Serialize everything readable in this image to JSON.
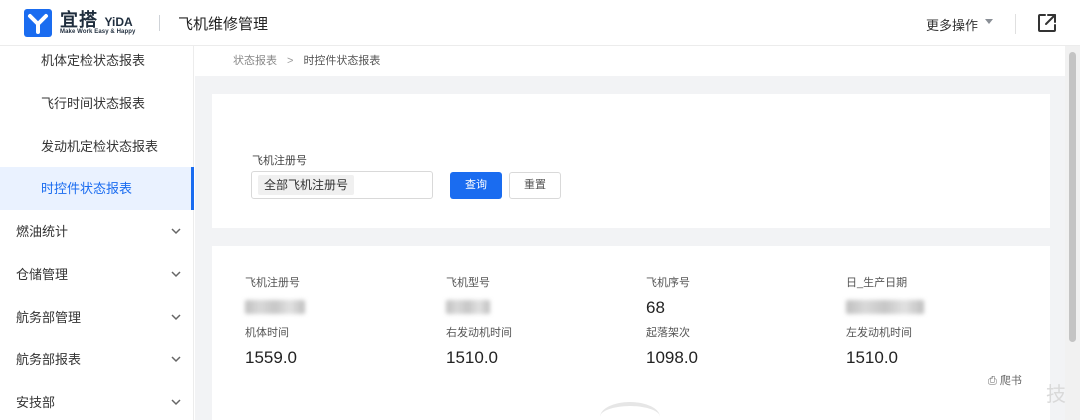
{
  "header": {
    "brand_cn": "宜搭",
    "brand_en": "YiDA",
    "brand_slogan": "Make Work Easy & Happy",
    "app_title": "飞机维修管理",
    "more_ops": "更多操作"
  },
  "sidebar": {
    "sub_items": [
      {
        "label": "机体定检状态报表",
        "active": false
      },
      {
        "label": "飞行时间状态报表",
        "active": false
      },
      {
        "label": "发动机定检状态报表",
        "active": false
      },
      {
        "label": "时控件状态报表",
        "active": true
      }
    ],
    "groups": [
      {
        "label": "燃油统计"
      },
      {
        "label": "仓储管理"
      },
      {
        "label": "航务部管理"
      },
      {
        "label": "航务部报表"
      },
      {
        "label": "安技部"
      }
    ]
  },
  "breadcrumb": {
    "parent": "状态报表",
    "separator": ">",
    "current": "时控件状态报表"
  },
  "query": {
    "field_label": "飞机注册号",
    "tag_value": "全部飞机注册号",
    "query_button": "查询",
    "reset_button": "重置"
  },
  "info": {
    "row1": [
      {
        "label": "飞机注册号",
        "value": ""
      },
      {
        "label": "飞机型号",
        "value": ""
      },
      {
        "label": "飞机序号",
        "value": "68"
      },
      {
        "label": "日_生产日期",
        "value": ""
      }
    ],
    "row2": [
      {
        "label": "机体时间",
        "value": "1559.0"
      },
      {
        "label": "右发动机时间",
        "value": "1510.0"
      },
      {
        "label": "起落架次",
        "value": "1098.0"
      },
      {
        "label": "左发动机时间",
        "value": "1510.0"
      }
    ]
  },
  "watermark": {
    "text": "爬书",
    "glyph": "技"
  },
  "colors": {
    "accent": "#1a6cf0",
    "active_bg": "#eaf2ff",
    "page_bg": "#f2f3f5"
  }
}
